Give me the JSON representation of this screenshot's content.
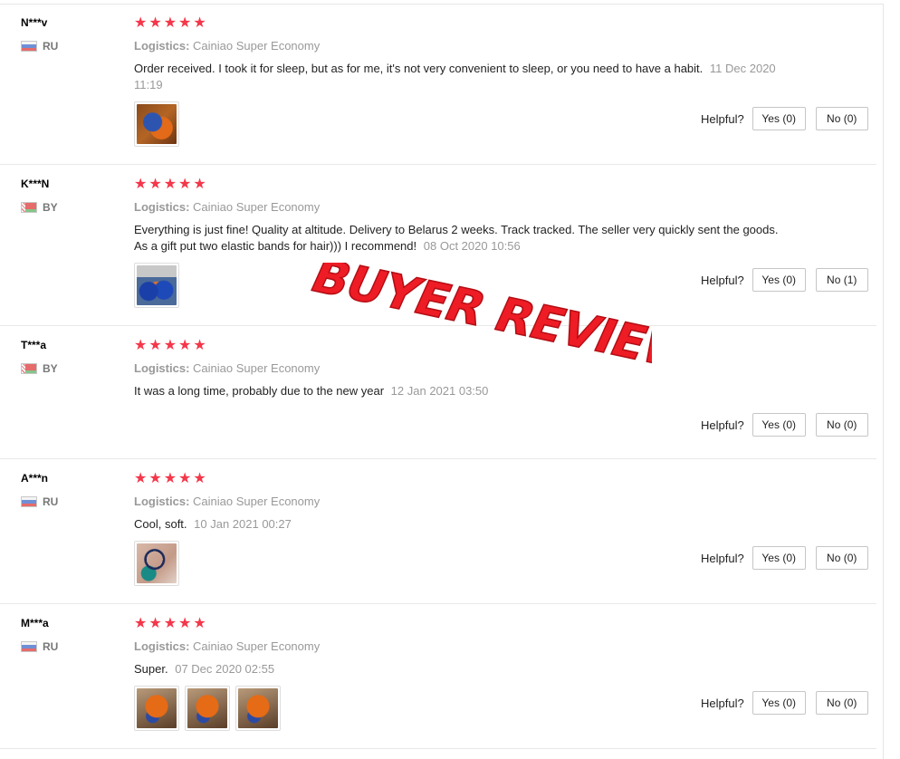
{
  "helpful_label": "Helpful?",
  "logistics_label": "Logistics:",
  "star_glyph": "★",
  "overlay_text": "BUYER REVIEW",
  "colors": {
    "star": "#f4374a",
    "overlay": "#ee1c25"
  },
  "reviews": [
    {
      "user": "N***v",
      "country": "RU",
      "rating": 5,
      "logistics": "Cainiao Super Economy",
      "text": "Order received. I took it for sleep, but as for me, it's not very convenient to sleep, or you need to have a habit.",
      "date": "11 Dec 2020 11:19",
      "yes": "Yes (0)",
      "no": "No (0)"
    },
    {
      "user": "K***N",
      "country": "BY",
      "rating": 5,
      "logistics": "Cainiao Super Economy",
      "text": "Everything is just fine! Quality at altitude. Delivery to Belarus 2 weeks. Track tracked. The seller very quickly sent the goods. As a gift put two elastic bands for hair))) I recommend!",
      "date": "08 Oct 2020 10:56",
      "yes": "Yes (0)",
      "no": "No (1)"
    },
    {
      "user": "T***a",
      "country": "BY",
      "rating": 5,
      "logistics": "Cainiao Super Economy",
      "text": "It was a long time, probably due to the new year",
      "date": "12 Jan 2021 03:50",
      "yes": "Yes (0)",
      "no": "No (0)"
    },
    {
      "user": "A***n",
      "country": "RU",
      "rating": 5,
      "logistics": "Cainiao Super Economy",
      "text": "Cool, soft.",
      "date": "10 Jan 2021 00:27",
      "yes": "Yes (0)",
      "no": "No (0)"
    },
    {
      "user": "M***a",
      "country": "RU",
      "rating": 5,
      "logistics": "Cainiao Super Economy",
      "text": "Super.",
      "date": "07 Dec 2020 02:55",
      "yes": "Yes (0)",
      "no": "No (0)"
    }
  ]
}
